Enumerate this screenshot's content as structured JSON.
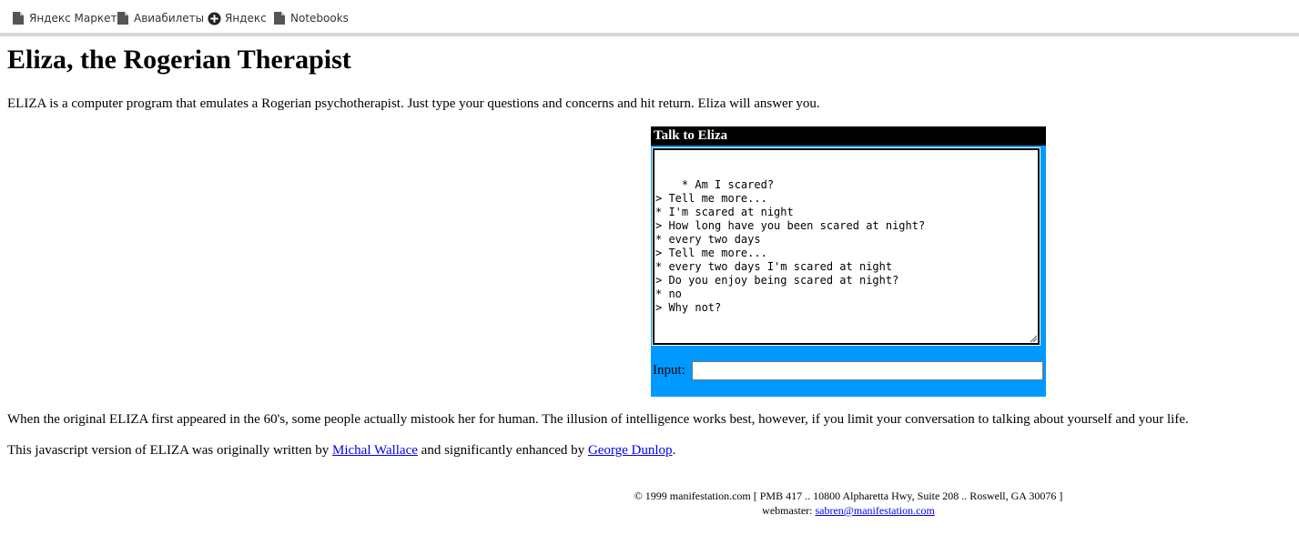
{
  "bookmarks": [
    {
      "label": "Яндекс Маркет",
      "icon": "document-icon"
    },
    {
      "label": "Авиабилеты",
      "icon": "document-icon"
    },
    {
      "label": "Яндекс",
      "icon": "yandex-icon"
    },
    {
      "label": "Notebooks",
      "icon": "document-icon"
    }
  ],
  "page": {
    "title": "Eliza, the Rogerian Therapist",
    "intro": "ELIZA is a computer program that emulates a Rogerian psychotherapist. Just type your questions and concerns and hit return. Eliza will answer you."
  },
  "eliza": {
    "title": "Talk to Eliza",
    "dialog": "* Am I scared?\n> Tell me more...\n* I'm scared at night\n> How long have you been scared at night?\n* every two days\n> Tell me more...\n* every two days I'm scared at night\n> Do you enjoy being scared at night?\n* no\n> Why not?",
    "input_label": "Input:",
    "input_value": "",
    "box_color": "#0099ff",
    "title_bg": "#000000"
  },
  "paragraphs": {
    "original": "When the original ELIZA first appeared in the 60's, some people actually mistook her for human. The illusion of intelligence works best, however, if you limit your conversation to talking about yourself and your life.",
    "version_prefix": "This javascript version of ELIZA was originally written by ",
    "author1": "Michal Wallace",
    "version_middle": " and significantly enhanced by ",
    "author2": "George Dunlop",
    "version_suffix": "."
  },
  "footer": {
    "line1": "© 1999 manifestation.com [ PMB 417 .. 10800 Alpharetta Hwy, Suite 208 .. Roswell, GA 30076 ]",
    "webmaster_label": "webmaster: ",
    "webmaster_email": "sabren@manifestation.com"
  },
  "colors": {
    "link": "#0000ee",
    "bookmark_bar_border": "#d5dade"
  }
}
